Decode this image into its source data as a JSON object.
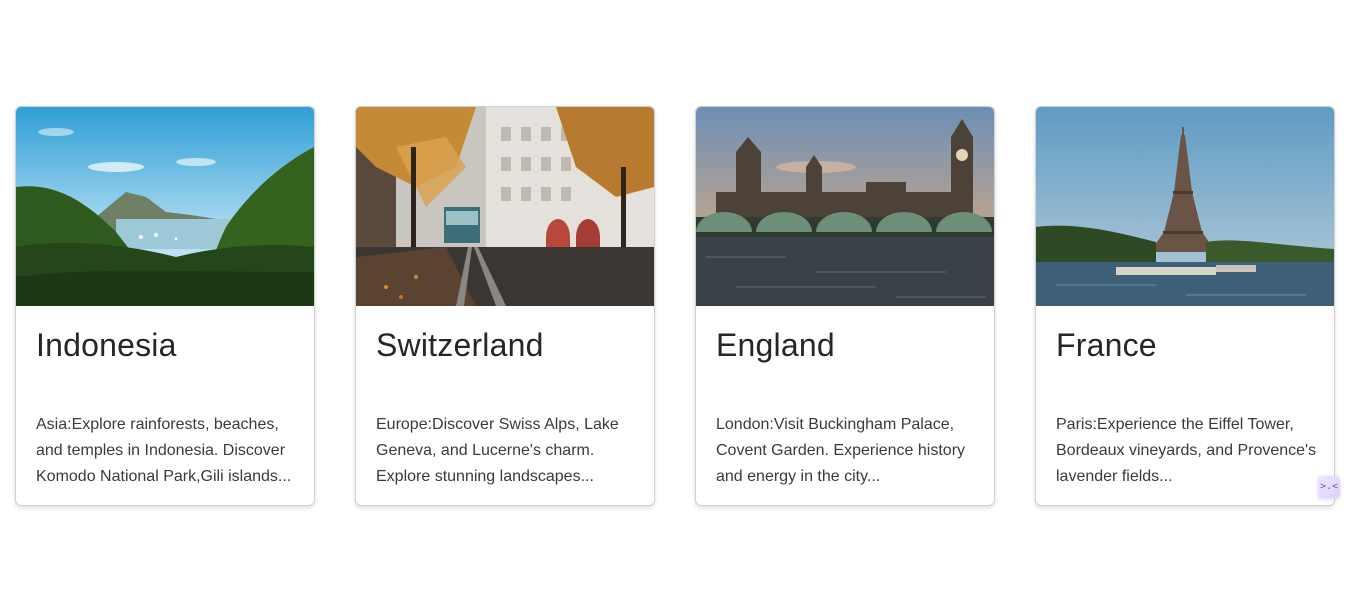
{
  "cards": [
    {
      "image_icon": "tropical-bay-photo",
      "title": "Indonesia",
      "text": "Asia:Explore rainforests, beaches, and temples in Indonesia. Discover Komodo National Park,Gili islands..."
    },
    {
      "image_icon": "city-street-tram-photo",
      "title": "Switzerland",
      "text": "Europe:Discover Swiss Alps, Lake Geneva, and Lucerne's charm. Explore stunning landscapes..."
    },
    {
      "image_icon": "parliament-big-ben-photo",
      "title": "England",
      "text": "London:Visit Buckingham Palace, Covent Garden. Experience history and energy in the city..."
    },
    {
      "image_icon": "eiffel-tower-river-photo",
      "title": "France",
      "text": "Paris:Experience the Eiffel Tower, Bordeaux vineyards, and Provence's lavender fields..."
    }
  ],
  "widget": {
    "icon": "collapse-arrows-icon",
    "glyph": ">.<"
  }
}
